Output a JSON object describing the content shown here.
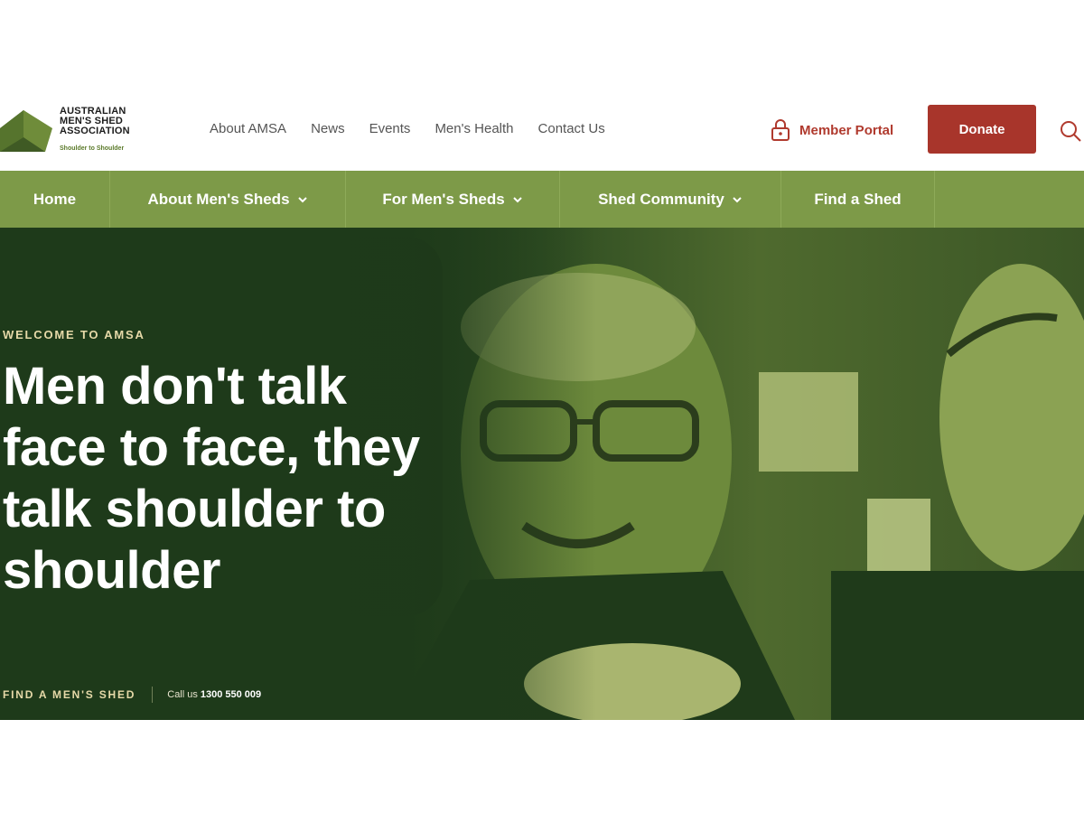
{
  "logo": {
    "lines": [
      "AUSTRALIAN",
      "MEN'S SHED",
      "ASSOCIATION"
    ],
    "tagline": "Shoulder to Shoulder"
  },
  "topnav": [
    "About AMSA",
    "News",
    "Events",
    "Men's Health",
    "Contact Us"
  ],
  "portal": {
    "label": "Member Portal",
    "icon": "lock-icon"
  },
  "donate_label": "Donate",
  "mainnav": [
    {
      "label": "Home",
      "dropdown": false
    },
    {
      "label": "About Men's Sheds",
      "dropdown": true
    },
    {
      "label": "For Men's Sheds",
      "dropdown": true
    },
    {
      "label": "Shed Community",
      "dropdown": true
    },
    {
      "label": "Find a Shed",
      "dropdown": false
    }
  ],
  "hero": {
    "eyebrow": "WELCOME TO AMSA",
    "headline_lines": [
      "Men don't talk",
      "face to face, they",
      "talk shoulder to",
      "shoulder"
    ],
    "cta_find": "FIND A MEN'S SHED",
    "cta_call": "Call us",
    "cta_phone": "1300 550 009"
  },
  "colors": {
    "brand_green": "#7d9a48",
    "hero_dark": "#1e3a1a",
    "donate_red": "#a8352b",
    "portal_red": "#b03a2e"
  }
}
